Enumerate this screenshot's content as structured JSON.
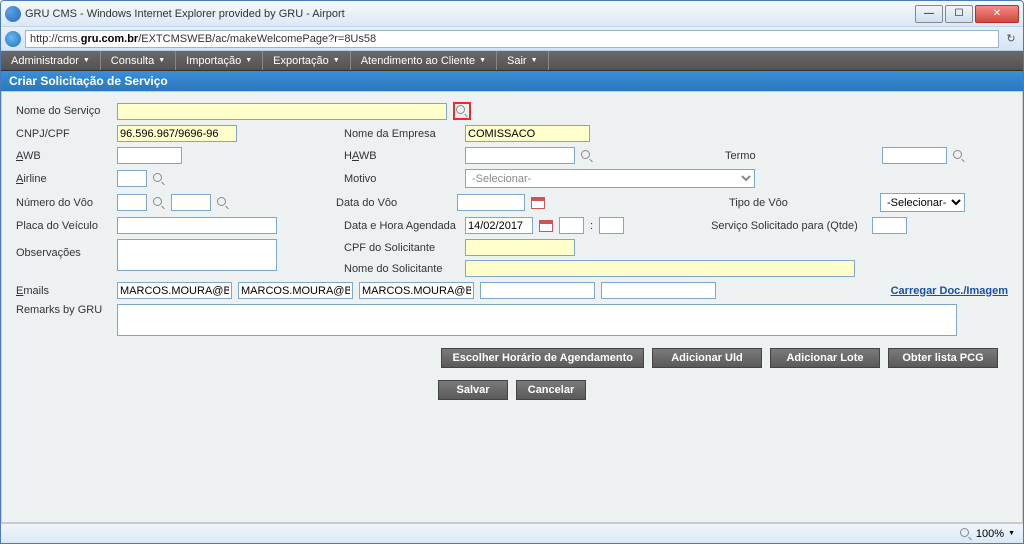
{
  "window": {
    "title": "GRU CMS - Windows Internet Explorer provided by GRU - Airport",
    "url_prefix": "http://cms.",
    "url_domain": "gru.com.br",
    "url_path": "/EXTCMSWEB/ac/makeWelcomePage?r=8Us58"
  },
  "menu": {
    "administrador": "Administrador",
    "consulta": "Consulta",
    "importacao": "Importação",
    "exportacao": "Exportação",
    "atendimento": "Atendimento ao Cliente",
    "sair": "Sair"
  },
  "page": {
    "title": "Criar Solicitação de Serviço"
  },
  "labels": {
    "nome_servico": "Nome do Serviço",
    "cnpj_cpf": "CNPJ/CPF",
    "nome_empresa": "Nome da Empresa",
    "awb": "AWB",
    "hawb": "HAWB",
    "termo": "Termo",
    "airline": "Airline",
    "motivo": "Motivo",
    "numero_voo": "Número do Vôo",
    "data_voo": "Data do Vôo",
    "tipo_voo": "Tipo de Vôo",
    "placa_veiculo": "Placa do Veículo",
    "data_hora_agendada": "Data e Hora Agendada",
    "servico_qtde": "Serviço Solicitado para (Qtde)",
    "observacoes": "Observações",
    "cpf_solicitante": "CPF do Solicitante",
    "nome_solicitante": "Nome do Solicitante",
    "emails": "Emails",
    "remarks": "Remarks by GRU",
    "carregar_doc": "Carregar Doc./Imagem",
    "colon": ":"
  },
  "values": {
    "nome_servico": "",
    "cnpj_cpf": "96.596.967/9696-96",
    "nome_empresa": "COMISSACO",
    "awb": "",
    "hawb": "",
    "termo": "",
    "airline": "",
    "motivo_placeholder": "-Selecionar-",
    "numero_voo_a": "",
    "numero_voo_b": "",
    "data_voo": "",
    "tipo_voo_placeholder": "-Selecionar-",
    "placa_veiculo": "",
    "data_agendada": "14/02/2017",
    "hora_h": "",
    "hora_m": "",
    "servico_qtde": "",
    "observacoes": "",
    "cpf_solicitante": "",
    "nome_solicitante": "",
    "email1": "MARCOS.MOURA@BR",
    "email2": "MARCOS.MOURA@BR",
    "email3": "MARCOS.MOURA@BR",
    "email4": "",
    "email5": "",
    "remarks": ""
  },
  "buttons": {
    "escolher": "Escolher Horário de Agendamento",
    "adicionar_uld": "Adicionar Uld",
    "adicionar_lote": "Adicionar Lote",
    "obter_pcg": "Obter lista PCG",
    "salvar": "Salvar",
    "cancelar": "Cancelar"
  },
  "status": {
    "zoom": "100%"
  }
}
